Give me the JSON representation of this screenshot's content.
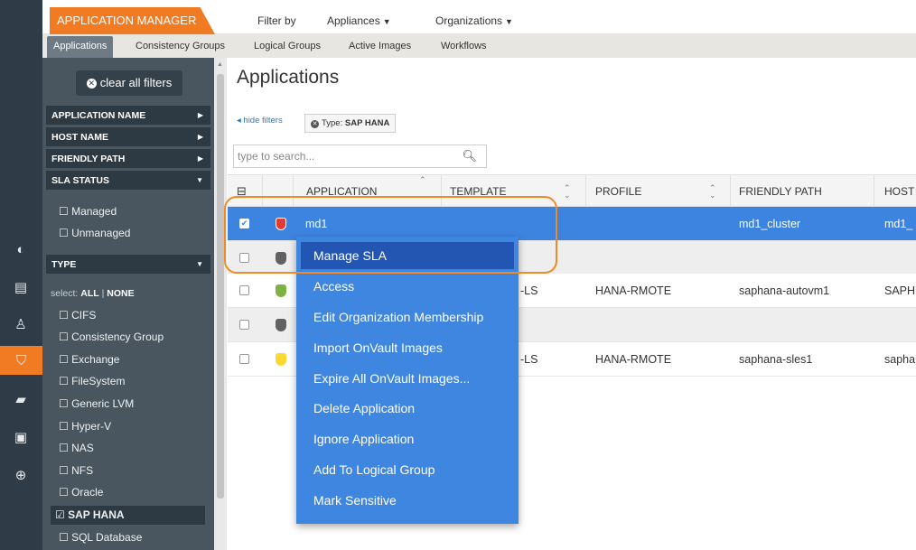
{
  "topbar": {
    "app_name": "APPLICATION MANAGER",
    "filter_by": "Filter by",
    "appliances": "Appliances",
    "organizations": "Organizations"
  },
  "tabs": [
    "Applications",
    "Consistency Groups",
    "Logical Groups",
    "Active Images",
    "Workflows"
  ],
  "rail_icons": [
    "dashboard-icon",
    "storage-icon",
    "monitor-icon",
    "app-manager-icon",
    "report-icon",
    "system-monitor-icon",
    "upload-icon"
  ],
  "filters": {
    "clear_label": "clear all filters",
    "facets": [
      {
        "label": "APPLICATION NAME"
      },
      {
        "label": "HOST NAME"
      },
      {
        "label": "FRIENDLY PATH"
      },
      {
        "label": "SLA STATUS"
      },
      {
        "label": "TYPE"
      }
    ],
    "sla_options": [
      "☐ Managed",
      "☐ Unmanaged"
    ],
    "select_prefix": "select: ",
    "select_all": "ALL",
    "select_sep": " | ",
    "select_none": "NONE",
    "type_options": [
      "☐ CIFS",
      "☐ Consistency Group",
      "☐ Exchange",
      "☐ FileSystem",
      "☐ Generic LVM",
      "☐ Hyper-V",
      "☐ NAS",
      "☐ NFS",
      "☐ Oracle",
      "☑ SAP HANA",
      "☐ SQL Database"
    ]
  },
  "main": {
    "title": "Applications",
    "hide_filters": "◂ hide filters",
    "pill_label": "Type:",
    "pill_value": "SAP HANA",
    "search_placeholder": "type to search...",
    "columns": [
      "APPLICATION",
      "TEMPLATE",
      "PROFILE",
      "FRIENDLY PATH",
      "HOST"
    ],
    "rows": [
      {
        "application": "md1",
        "template": "",
        "profile": "",
        "friendly_path": "md1_cluster",
        "host": "md1_",
        "checked": true,
        "shield": "#e53935"
      },
      {
        "application": "",
        "template": "",
        "profile": "",
        "friendly_path": "",
        "host": "",
        "checked": false,
        "shield": "#616161"
      },
      {
        "application": "",
        "template": "-LS",
        "profile": "HANA-RMOTE",
        "friendly_path": "saphana-autovm1",
        "host": "SAPH",
        "checked": false,
        "shield": "#7cb342"
      },
      {
        "application": "",
        "template": "",
        "profile": "",
        "friendly_path": "",
        "host": "",
        "checked": false,
        "shield": "#616161"
      },
      {
        "application": "",
        "template": "-LS",
        "profile": "HANA-RMOTE",
        "friendly_path": "saphana-sles1",
        "host": "sapha",
        "checked": false,
        "shield": "#fdd835"
      }
    ]
  },
  "context_menu": [
    "Manage SLA",
    "Access",
    "Edit Organization Membership",
    "Import OnVault Images",
    "Expire All OnVault Images...",
    "Delete Application",
    "Ignore Application",
    "Add To Logical Group",
    "Mark Sensitive"
  ],
  "colors": {
    "accent": "#f07b22",
    "sidebar": "#49565f",
    "selected_row": "#3d84e0",
    "menu": "#3f86e0"
  }
}
